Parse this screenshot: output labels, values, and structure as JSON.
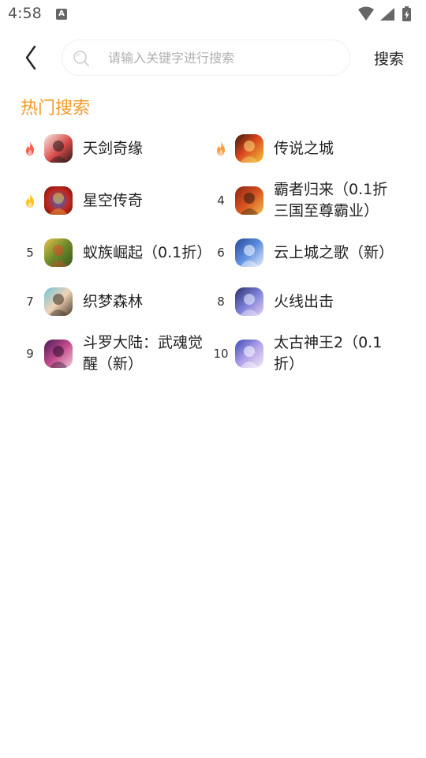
{
  "status_bar": {
    "time": "4:58",
    "notification_badge": "A"
  },
  "search": {
    "placeholder": "请输入关键字进行搜索",
    "value": "",
    "button_label": "搜索"
  },
  "hot_search": {
    "title": "热门搜索",
    "accent_color": "#f39a26",
    "items": [
      {
        "rank": "1",
        "rank_icon": "fire-icon",
        "rank_color": "#ff5a4e",
        "name": "天剑奇缘",
        "icon": "game-icon-tianjian"
      },
      {
        "rank": "2",
        "rank_icon": "fire-icon",
        "rank_color": "#ff9b3f",
        "name": "传说之城",
        "icon": "game-icon-chuanshuo"
      },
      {
        "rank": "3",
        "rank_icon": "fire-icon",
        "rank_color": "#ffc21a",
        "name": "星空传奇",
        "icon": "game-icon-xingkong"
      },
      {
        "rank": "4",
        "rank_icon": "",
        "rank_color": "",
        "name": "霸者归来（0.1折三国至尊霸业）",
        "icon": "game-icon-bazhe"
      },
      {
        "rank": "5",
        "rank_icon": "",
        "rank_color": "",
        "name": "蚁族崛起（0.1折）",
        "icon": "game-icon-yizu"
      },
      {
        "rank": "6",
        "rank_icon": "",
        "rank_color": "",
        "name": "云上城之歌（新）",
        "icon": "game-icon-yunshang"
      },
      {
        "rank": "7",
        "rank_icon": "",
        "rank_color": "",
        "name": "织梦森林",
        "icon": "game-icon-zhimeng"
      },
      {
        "rank": "8",
        "rank_icon": "",
        "rank_color": "",
        "name": "火线出击",
        "icon": "game-icon-huoxian"
      },
      {
        "rank": "9",
        "rank_icon": "",
        "rank_color": "",
        "name": "斗罗大陆：武魂觉醒（新）",
        "icon": "game-icon-douluo"
      },
      {
        "rank": "10",
        "rank_icon": "",
        "rank_color": "",
        "name": "太古神王2（0.1折）",
        "icon": "game-icon-taigu"
      }
    ]
  }
}
